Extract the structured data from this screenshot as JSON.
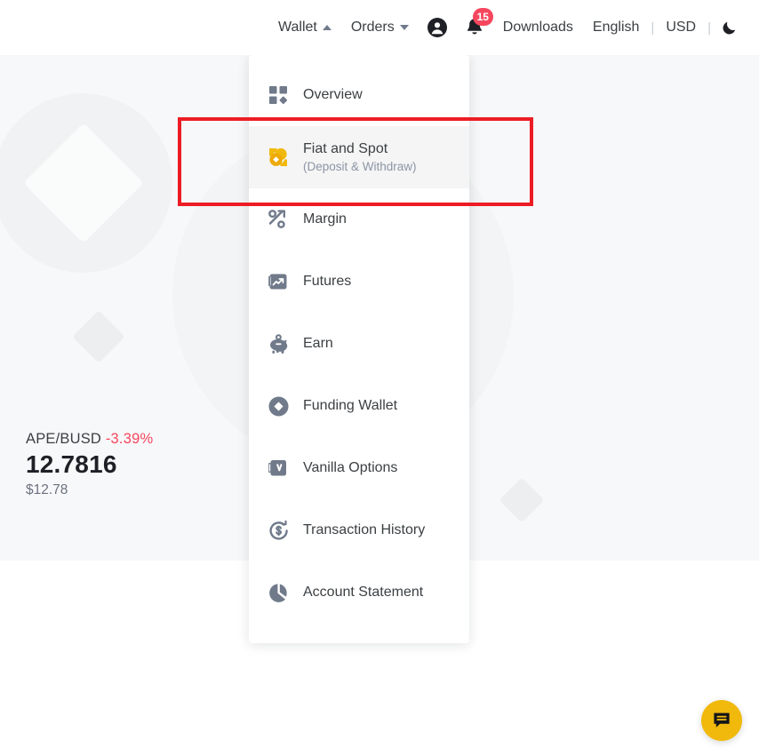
{
  "header": {
    "wallet": {
      "label": "Wallet",
      "icon": "caret-up-icon"
    },
    "orders": {
      "label": "Orders",
      "icon": "caret-down-icon"
    },
    "account_icon": "user-account-icon",
    "notifications": {
      "icon": "bell-icon",
      "count": "15"
    },
    "downloads": "Downloads",
    "language": "English",
    "currency": "USD",
    "separator": "|",
    "theme_toggle_icon": "moon-icon"
  },
  "dropdown": {
    "items": [
      {
        "label": "Overview",
        "sub": "",
        "icon": "grid-overview-icon",
        "active": false
      },
      {
        "label": "Fiat and Spot",
        "sub": "(Deposit & Withdraw)",
        "icon": "coins-fiat-spot-icon",
        "active": true
      },
      {
        "label": "Margin",
        "sub": "",
        "icon": "percent-arrow-margin-icon",
        "active": false
      },
      {
        "label": "Futures",
        "sub": "",
        "icon": "futures-chart-icon",
        "active": false
      },
      {
        "label": "Earn",
        "sub": "",
        "icon": "piggy-bank-earn-icon",
        "active": false
      },
      {
        "label": "Funding Wallet",
        "sub": "",
        "icon": "diamond-circle-funding-icon",
        "active": false
      },
      {
        "label": "Vanilla Options",
        "sub": "",
        "icon": "vanilla-options-icon",
        "active": false
      },
      {
        "label": "Transaction History",
        "sub": "",
        "icon": "dollar-clock-history-icon",
        "active": false
      },
      {
        "label": "Account Statement",
        "sub": "",
        "icon": "pie-chart-statement-icon",
        "active": false
      }
    ]
  },
  "ticker": {
    "pair": "APE/BUSD",
    "change": "-3.39%",
    "price": "12.7816",
    "usd": "$12.78"
  },
  "chat": {
    "icon": "chat-bubble-icon"
  },
  "colors": {
    "accent_yellow": "#f0b90b",
    "negative_red": "#f6465d",
    "highlight_red": "#ed1c24",
    "hero_bg": "#f7f8f9",
    "icon_gray": "#707a8a"
  }
}
